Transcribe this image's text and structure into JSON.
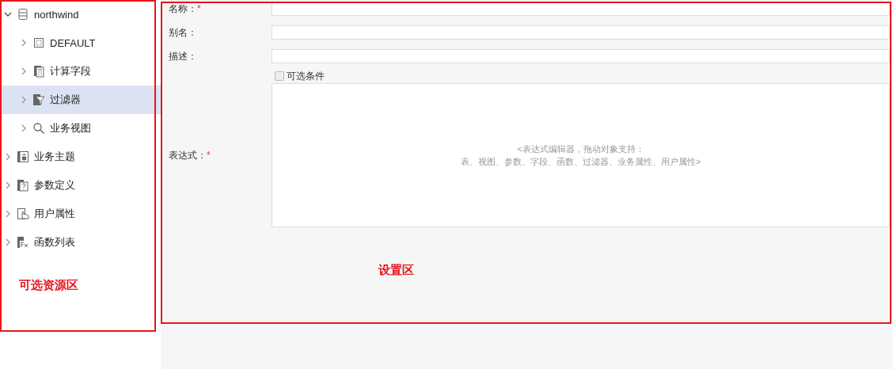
{
  "tree": [
    {
      "label": "northwind",
      "kind": "database",
      "expanded": true,
      "selected": false,
      "children": [
        {
          "label": "DEFAULT",
          "kind": "table",
          "expanded": false,
          "selected": false
        },
        {
          "label": "计算字段",
          "kind": "calc",
          "expanded": false,
          "selected": false
        },
        {
          "label": "过滤器",
          "kind": "filter",
          "expanded": false,
          "selected": true
        },
        {
          "label": "业务视图",
          "kind": "search",
          "expanded": false,
          "selected": false
        }
      ]
    },
    {
      "label": "业务主题",
      "kind": "subject",
      "expanded": false,
      "selected": false
    },
    {
      "label": "参数定义",
      "kind": "param",
      "expanded": false,
      "selected": false
    },
    {
      "label": "用户属性",
      "kind": "hand",
      "expanded": false,
      "selected": false
    },
    {
      "label": "函数列表",
      "kind": "function",
      "expanded": false,
      "selected": false
    }
  ],
  "form": {
    "fields": [
      {
        "label": "名称：",
        "required_mark": "*"
      },
      {
        "label": "别名："
      },
      {
        "label": "描述："
      }
    ],
    "optional_condition": {
      "label": "可选条件",
      "checked": false
    },
    "expression": {
      "label": "表达式：",
      "required_mark": "*",
      "placeholder_lines": [
        "<表达式编辑器，拖动对象支持：",
        "表、视图、参数、字段、函数、过滤器、业务属性、用户属性>"
      ]
    }
  },
  "annotations": [
    "可选资源区",
    "设置区"
  ]
}
